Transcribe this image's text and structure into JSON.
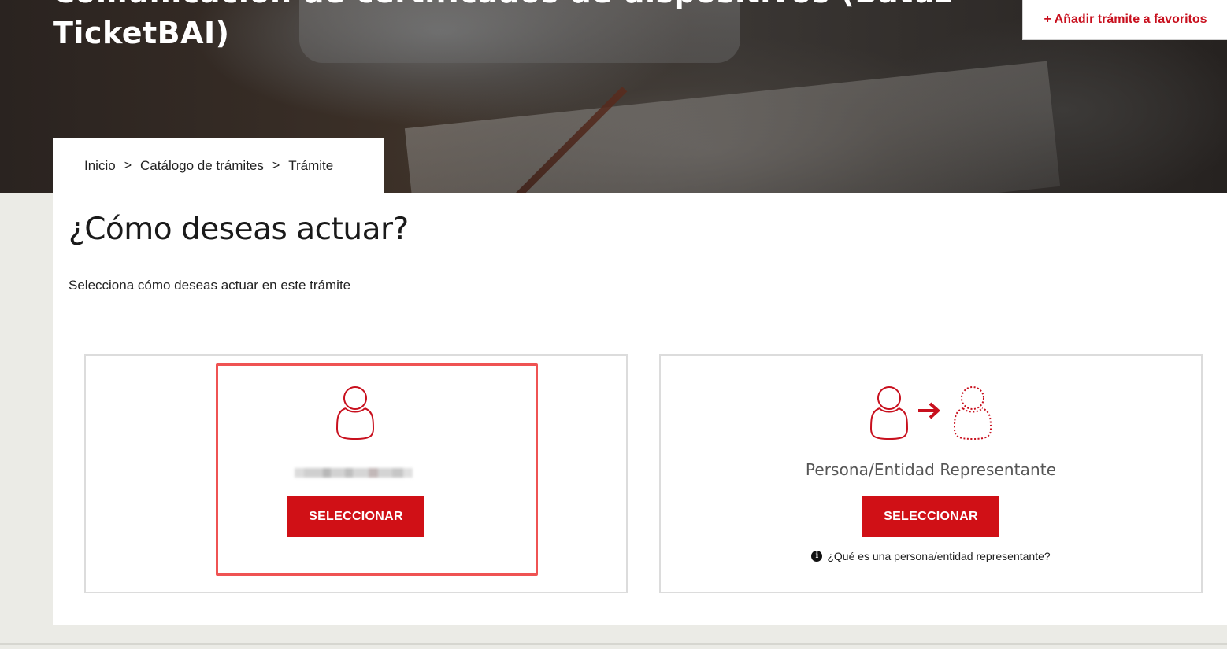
{
  "header": {
    "title": "Comunicación de certificados de dispositivos (Batuz TicketBAI)",
    "favorites_button": "+ Añadir trámite a favoritos"
  },
  "breadcrumb": {
    "items": [
      "Inicio",
      "Catálogo de trámites",
      "Trámite"
    ],
    "separator": ">"
  },
  "main": {
    "title": "¿Cómo deseas actuar?",
    "subtitle": "Selecciona cómo deseas actuar en este trámite"
  },
  "options": [
    {
      "icon": "person-icon",
      "label": "",
      "label_blurred": true,
      "button": "SELECCIONAR"
    },
    {
      "icon": "representative-icon",
      "label": "Persona/Entidad Representante",
      "button": "SELECCIONAR",
      "help_link": "¿Qué es una persona/entidad representante?"
    }
  ],
  "colors": {
    "accent": "#d01016",
    "highlight": "#ef5353",
    "icon_red": "#c8101e"
  }
}
